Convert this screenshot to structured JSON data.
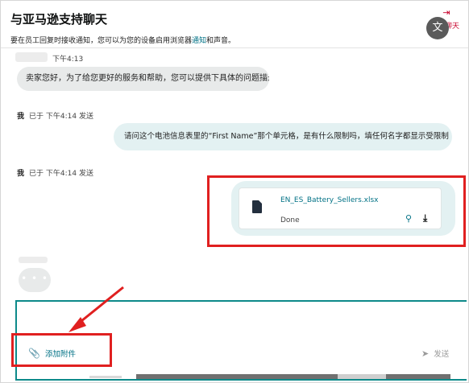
{
  "header": {
    "title": "与亚马逊支持聊天",
    "subtitle_prefix": "要在员工回复时接收通知，您可以为您的设备启用浏览器",
    "subtitle_link": "通知",
    "subtitle_suffix": "和声音。",
    "top_icon_label": "关闭聊天",
    "translate_icon": "translate-icon"
  },
  "messages": [
    {
      "time": "下午4:13",
      "text": "卖家您好，为了给您更好的服务和帮助，您可以提供下具体的问题描述"
    },
    {
      "sender": "我",
      "meta": "已于 下午4:14 发送",
      "text": "请问这个电池信息表里的“First Name”那个单元格，是有什么限制吗，填任何名字都显示受限制"
    },
    {
      "sender": "我",
      "meta": "已于 下午4:14 发送",
      "file": {
        "name": "EN_ES_Battery_Sellers.xlsx",
        "status": "Done",
        "icon": "document-icon"
      }
    }
  ],
  "typing_indicator": "• • •",
  "composer": {
    "attach_label": "添加附件",
    "send_label": "发送",
    "attach_icon": "paperclip-icon",
    "send_icon": "send-icon"
  },
  "colors": {
    "accent": "#007185",
    "input_border": "#0d8a8a",
    "highlight": "#e02020",
    "bubble_in": "#e8eaea",
    "bubble_out": "#e3f1f2"
  }
}
